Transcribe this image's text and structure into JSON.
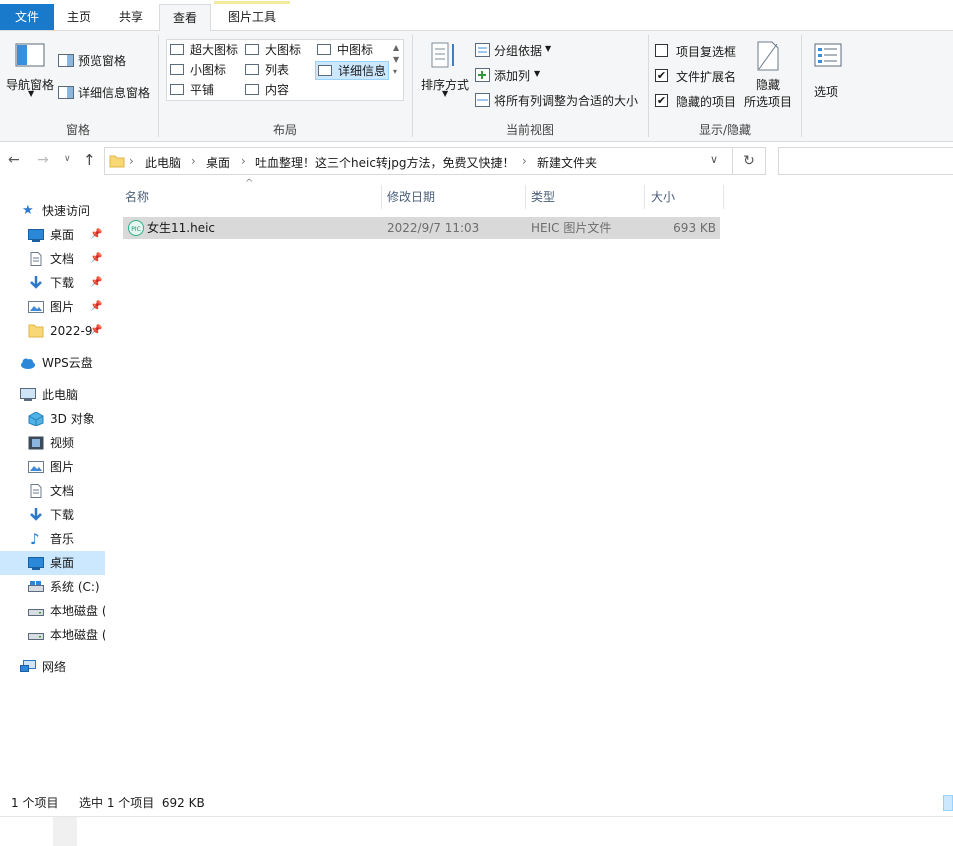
{
  "tabs": [
    {
      "label": "文件"
    },
    {
      "label": "主页"
    },
    {
      "label": "共享"
    },
    {
      "label": "查看"
    },
    {
      "label": "图片工具"
    }
  ],
  "ribbon": {
    "panes": {
      "nav_pane": "导航窗格",
      "preview_pane": "预览窗格",
      "details_pane": "详细信息窗格",
      "label": "窗格"
    },
    "layout": {
      "items": [
        "超大图标",
        "大图标",
        "中图标",
        "小图标",
        "列表",
        "详细信息",
        "平铺",
        "内容"
      ],
      "selected": "详细信息",
      "label": "布局"
    },
    "current_view": {
      "sort_by": "排序方式",
      "group_by": "分组依据",
      "add_column": "添加列",
      "fit_columns": "将所有列调整为合适的大小",
      "label": "当前视图"
    },
    "show_hide": {
      "item_checkboxes": {
        "label": "项目复选框",
        "checked": false
      },
      "file_extensions": {
        "label": "文件扩展名",
        "checked": true
      },
      "hidden_items": {
        "label": "隐藏的项目",
        "checked": true
      },
      "hide_selected_line1": "隐藏",
      "hide_selected_line2": "所选项目",
      "label": "显示/隐藏"
    },
    "options": "选项"
  },
  "address": {
    "crumbs": [
      "此电脑",
      "桌面",
      "吐血整理！这三个heic转jpg方法，免费又快捷！",
      "新建文件夹"
    ]
  },
  "sidebar": {
    "items": [
      {
        "label": "快速访问",
        "icon": "star-icon"
      },
      {
        "label": "桌面",
        "icon": "desktop-icon",
        "pinned": true
      },
      {
        "label": "文档",
        "icon": "document-icon",
        "pinned": true
      },
      {
        "label": "下载",
        "icon": "download-icon",
        "pinned": true
      },
      {
        "label": "图片",
        "icon": "picture-icon",
        "pinned": true
      },
      {
        "label": "2022-9",
        "icon": "folder-icon",
        "pinned": true
      },
      {
        "label": "WPS云盘",
        "icon": "cloud-icon"
      },
      {
        "label": "此电脑",
        "icon": "computer-icon"
      },
      {
        "label": "3D 对象",
        "icon": "cube-icon"
      },
      {
        "label": "视频",
        "icon": "video-icon"
      },
      {
        "label": "图片",
        "icon": "picture-icon"
      },
      {
        "label": "文档",
        "icon": "document-icon"
      },
      {
        "label": "下载",
        "icon": "download-icon"
      },
      {
        "label": "音乐",
        "icon": "music-icon"
      },
      {
        "label": "桌面",
        "icon": "desktop-icon",
        "selected": true
      },
      {
        "label": "系统 (C:)",
        "icon": "drive-c-icon"
      },
      {
        "label": "本地磁盘 (",
        "icon": "drive-icon"
      },
      {
        "label": "本地磁盘 (",
        "icon": "drive-icon"
      },
      {
        "label": "网络",
        "icon": "network-icon"
      }
    ]
  },
  "columns": [
    "名称",
    "修改日期",
    "类型",
    "大小"
  ],
  "files": [
    {
      "name": "女生11.heic",
      "modified": "2022/9/7 11:03",
      "type": "HEIC 图片文件",
      "size": "693 KB",
      "selected": true
    }
  ],
  "status": {
    "item_count": "1 个项目",
    "selection": "选中 1 个项目  692 KB"
  },
  "colors": {
    "file_tab": "#1979ca",
    "selection": "#cce8ff",
    "row_selected": "#d9d9d9"
  }
}
